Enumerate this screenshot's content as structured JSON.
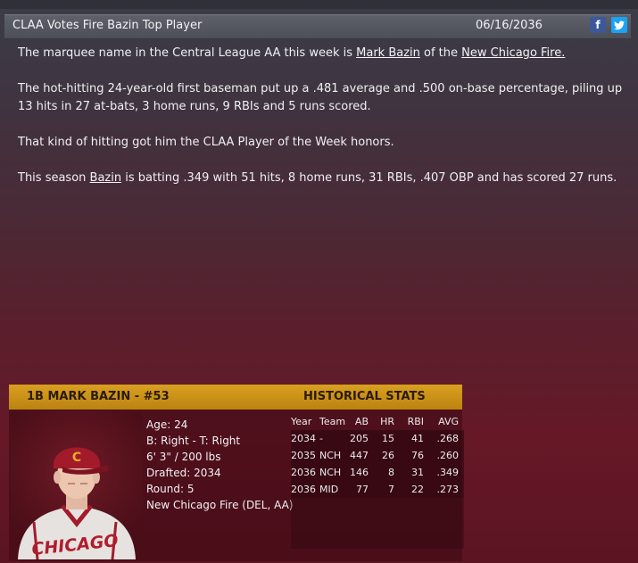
{
  "article": {
    "headline": "CLAA Votes Fire Bazin Top Player",
    "date": "06/16/2036",
    "share": {
      "facebook": "f",
      "twitter": "t"
    },
    "p1": {
      "prefix": "The marquee name in the Central League AA this week is ",
      "player_link": "Mark Bazin",
      "middle": " of the ",
      "team_link": "New Chicago Fire."
    },
    "p2": "The hot-hitting 24-year-old first baseman put up a .481 average and .500 on-base percentage, piling up 13 hits in 27 at-bats, 3 home runs, 9 RBIs and 5 runs scored.",
    "p3": "That kind of hitting got him the CLAA Player of the Week honors.",
    "p4": {
      "prefix": "This season ",
      "player_link": "Bazin",
      "suffix": " is batting .349 with 51 hits, 8 home runs, 31 RBIs, .407 OBP and has scored 27 runs."
    }
  },
  "player_card": {
    "title": "1B MARK BAZIN - #53",
    "hist_title": "HISTORICAL STATS",
    "bio": [
      "Age: 24",
      "B: Right - T: Right",
      "6' 3\" / 200 lbs",
      "Drafted: 2034",
      "Round: 5",
      "New Chicago Fire (DEL, AA)"
    ],
    "jersey_text": "CHICAGO",
    "cap_letter": "C",
    "stats": {
      "headers": [
        "Year",
        "Team",
        "AB",
        "HR",
        "RBI",
        "AVG"
      ],
      "rows": [
        [
          "2034",
          "-",
          "205",
          "15",
          "41",
          ".268"
        ],
        [
          "2035",
          "NCH",
          "447",
          "26",
          "76",
          ".260"
        ],
        [
          "2036",
          "NCH",
          "146",
          "8",
          "31",
          ".349"
        ],
        [
          "2036",
          "MID",
          "77",
          "7",
          "22",
          ".273"
        ]
      ]
    }
  },
  "colors": {
    "accent_gold": "#c88f16",
    "background_red": "#5c1422"
  }
}
